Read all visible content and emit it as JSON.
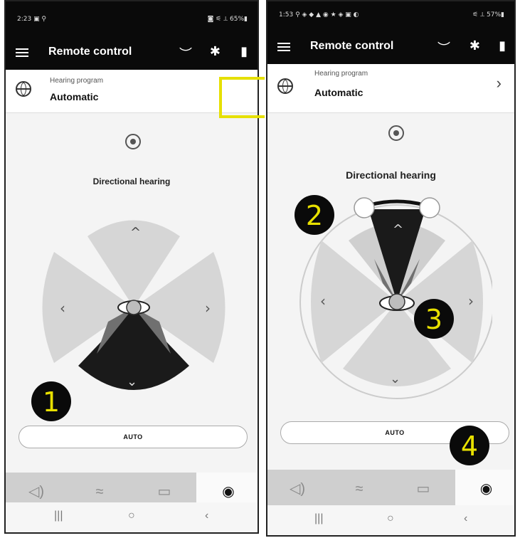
{
  "phone_left": {
    "status_time": "2:23 ▣ ⚲",
    "status_icons": "◙ ⚟ ⟂ 65%▮",
    "title": "Remote control",
    "program_label": "Hearing program",
    "program_value": "Automatic",
    "directional_label": "Directional hearing",
    "auto_label": "AUTO",
    "badge": "1"
  },
  "phone_right": {
    "status_time": "1:53 ⚲ ◈ ◆ ▲ ◉ ★ ◈ ▣ ◐",
    "status_icons": "⚟ ⟂ 57%▮",
    "title": "Remote control",
    "program_label": "Hearing program",
    "program_value": "Automatic",
    "directional_label": "Directional hearing",
    "auto_label": "AUTO",
    "badges": [
      "2",
      "3",
      "4"
    ]
  },
  "icons": {
    "menu": "≡",
    "headset": "︶",
    "bluetooth": "✱",
    "battery": "▮",
    "chevron_right": "›",
    "up": "^",
    "down": "⌄",
    "left": "‹",
    "right": "›",
    "nav_volume": "◁)",
    "nav_wave": "≈",
    "nav_screen": "▭",
    "nav_target": "◉",
    "sys_recent": "|||",
    "sys_home": "○",
    "sys_back": "‹"
  },
  "colors": {
    "callout": "#e6e000",
    "dark": "#0a0a0a",
    "petal": "#d6d6d6"
  }
}
